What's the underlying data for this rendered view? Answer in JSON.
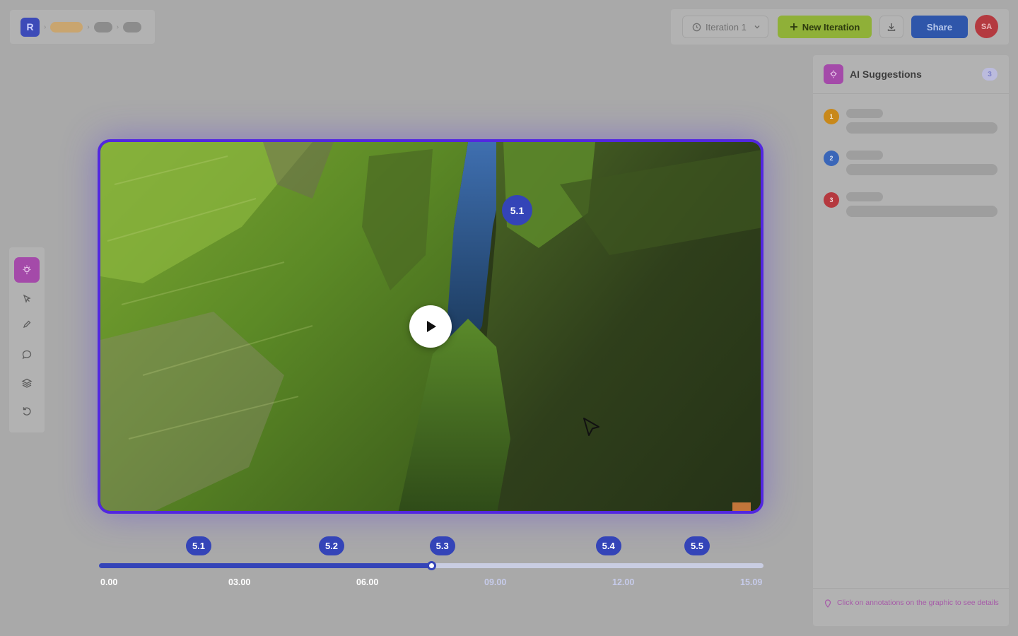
{
  "header": {
    "logo_letter": "R"
  },
  "toolbar": {
    "iteration_label": "Iteration 1",
    "new_iteration_label": "New Iteration",
    "share_label": "Share",
    "avatar_initials": "SA"
  },
  "tools": [
    "ai-suggestions-icon",
    "select-pointer-icon",
    "pen-icon",
    "comment-icon",
    "layers-icon",
    "undo-icon"
  ],
  "video": {
    "annotation_marker": "5.1",
    "playback_progress": 0.5
  },
  "timeline": {
    "markers": [
      {
        "label": "5.1",
        "time": 4.5
      },
      {
        "label": "5.2",
        "time": 10.5
      },
      {
        "label": "5.3",
        "time": 15.5
      },
      {
        "label": "5.4",
        "time": 23.0
      },
      {
        "label": "5.5",
        "time": 27.0
      }
    ],
    "ticks": [
      "0.00",
      "03.00",
      "06.00",
      "09.00",
      "12.00",
      "15.09"
    ],
    "played_ticks": 3
  },
  "sidebar": {
    "title": "AI Suggestions",
    "count": "3",
    "items": [
      {
        "number": "1",
        "color": "#c8881a"
      },
      {
        "number": "2",
        "color": "#3a66b8"
      },
      {
        "number": "3",
        "color": "#b5393f"
      }
    ],
    "footer_hint": "Click on annotations on the graphic to see details"
  },
  "colors": {
    "accent": "#3444b8",
    "ai_purple": "#a44aa9",
    "new_iteration_green": "#8fb038",
    "share_blue": "#2f56aa"
  }
}
